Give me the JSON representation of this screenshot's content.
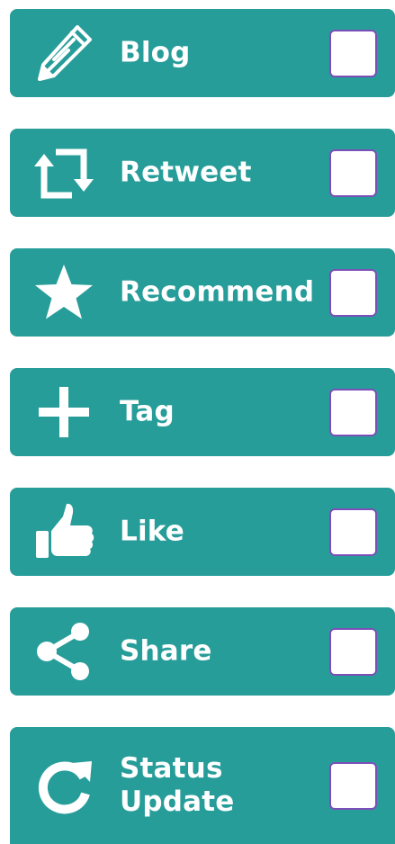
{
  "actions": [
    {
      "id": "blog",
      "label": "Blog",
      "icon": "pencil-icon",
      "checked": false
    },
    {
      "id": "retweet",
      "label": "Retweet",
      "icon": "retweet-icon",
      "checked": false
    },
    {
      "id": "recommend",
      "label": "Recommend",
      "icon": "star-icon",
      "checked": false
    },
    {
      "id": "tag",
      "label": "Tag",
      "icon": "plus-icon",
      "checked": false
    },
    {
      "id": "like",
      "label": "Like",
      "icon": "thumbs-up-icon",
      "checked": false
    },
    {
      "id": "share",
      "label": "Share",
      "icon": "share-icon",
      "checked": false
    },
    {
      "id": "status-update",
      "label": "Status\nUpdate",
      "icon": "refresh-icon",
      "checked": false
    }
  ],
  "colors": {
    "row_background": "#279d9a",
    "text": "#ffffff",
    "checkbox_border": "#7b4fb8"
  }
}
